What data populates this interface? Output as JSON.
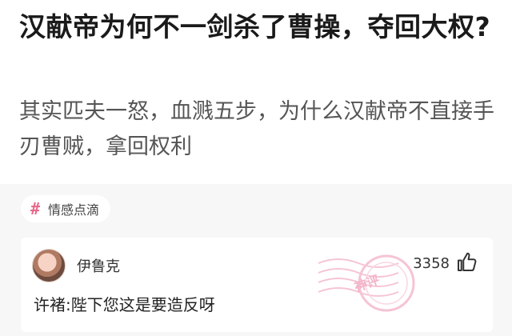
{
  "question": {
    "title": "汉献帝为何不一剑杀了曹操，夺回大权?",
    "detail": "其实匹夫一怒，血溅五步，为什么汉献帝不直接手刃曹贼，拿回权利"
  },
  "tag": {
    "icon": "hash-icon",
    "label": "情感点滴"
  },
  "comment": {
    "user": "伊鲁克",
    "likes": "3358",
    "text": "许褚:陛下您这是要造反呀",
    "watermark": "神评"
  },
  "colors": {
    "tag_icon": "#e86a8a",
    "band_background": "#f7f7f7",
    "watermark": "#f3b4c8"
  }
}
